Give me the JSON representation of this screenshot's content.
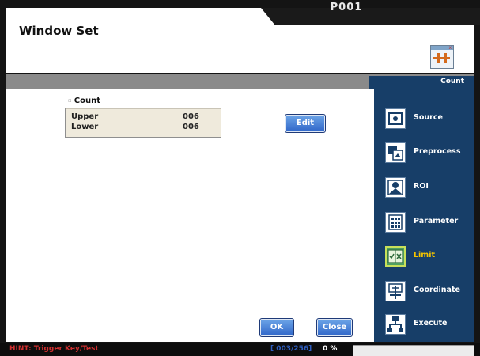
{
  "header": {
    "title": "Window Set",
    "program_id": "P001"
  },
  "panel": {
    "group_label": "Count",
    "rows": [
      {
        "label": "Upper",
        "value": "006"
      },
      {
        "label": "Lower",
        "value": "006"
      }
    ],
    "edit_label": "Edit",
    "ok_label": "OK",
    "close_label": "Close"
  },
  "nav": {
    "header": "Count",
    "items": [
      {
        "label": "Source",
        "icon": "source-icon"
      },
      {
        "label": "Preprocess",
        "icon": "preprocess-icon"
      },
      {
        "label": "ROI",
        "icon": "roi-icon"
      },
      {
        "label": "Parameter",
        "icon": "parameter-icon"
      },
      {
        "label": "Limit",
        "icon": "limit-icon",
        "active": true
      },
      {
        "label": "Coordinate",
        "icon": "coordinate-icon"
      },
      {
        "label": "Execute",
        "icon": "execute-icon"
      }
    ]
  },
  "status": {
    "hint": "HINT: Trigger Key/Test",
    "page_count": "[ 003/256]",
    "percent": "0 %"
  },
  "colors": {
    "nav_bg": "#173e68",
    "active_label": "#f5c400",
    "hint": "#d03030",
    "button": "#2e64c8"
  }
}
